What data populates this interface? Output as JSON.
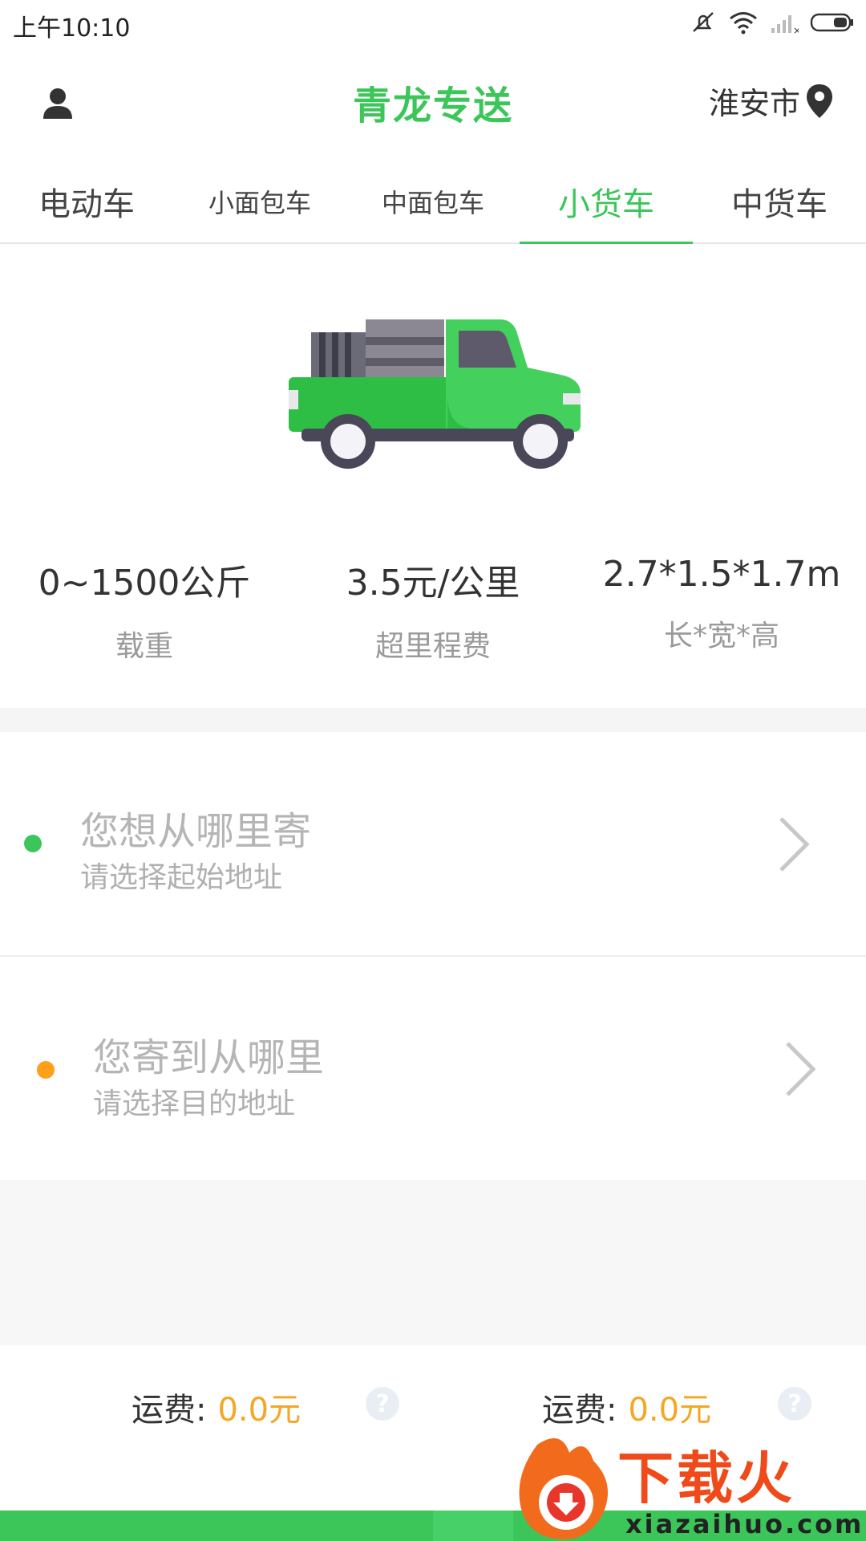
{
  "status_bar": {
    "time": "上午10:10",
    "icons": [
      "mute-icon",
      "wifi-icon",
      "signal-icon",
      "battery-icon"
    ]
  },
  "header": {
    "title": "青龙专送",
    "city": "淮安市",
    "title_color": "#3cc65a"
  },
  "tabs": [
    {
      "label": "电动车",
      "active": false
    },
    {
      "label": "小面包车",
      "active": false
    },
    {
      "label": "中面包车",
      "active": false
    },
    {
      "label": "小货车",
      "active": true
    },
    {
      "label": "中货车",
      "active": false
    }
  ],
  "specs": [
    {
      "value": "0~1500公斤",
      "label": "载重"
    },
    {
      "value": "3.5元/公里",
      "label": "超里程费"
    },
    {
      "value": "2.7*1.5*1.7m",
      "label": "长*宽*高"
    }
  ],
  "origin": {
    "title": "您想从哪里寄",
    "subtitle": "请选择起始地址",
    "dot_color": "#3cc65a"
  },
  "destination": {
    "title": "您寄到从哪里",
    "subtitle": "请选择目的地址",
    "dot_color": "#ff9f1a"
  },
  "fees": [
    {
      "label": "运费:",
      "value": "0.0元"
    },
    {
      "label": "运费:",
      "value": "0.0元"
    }
  ],
  "watermark": {
    "text": "下载火",
    "url": "xiazaihuo.com"
  }
}
